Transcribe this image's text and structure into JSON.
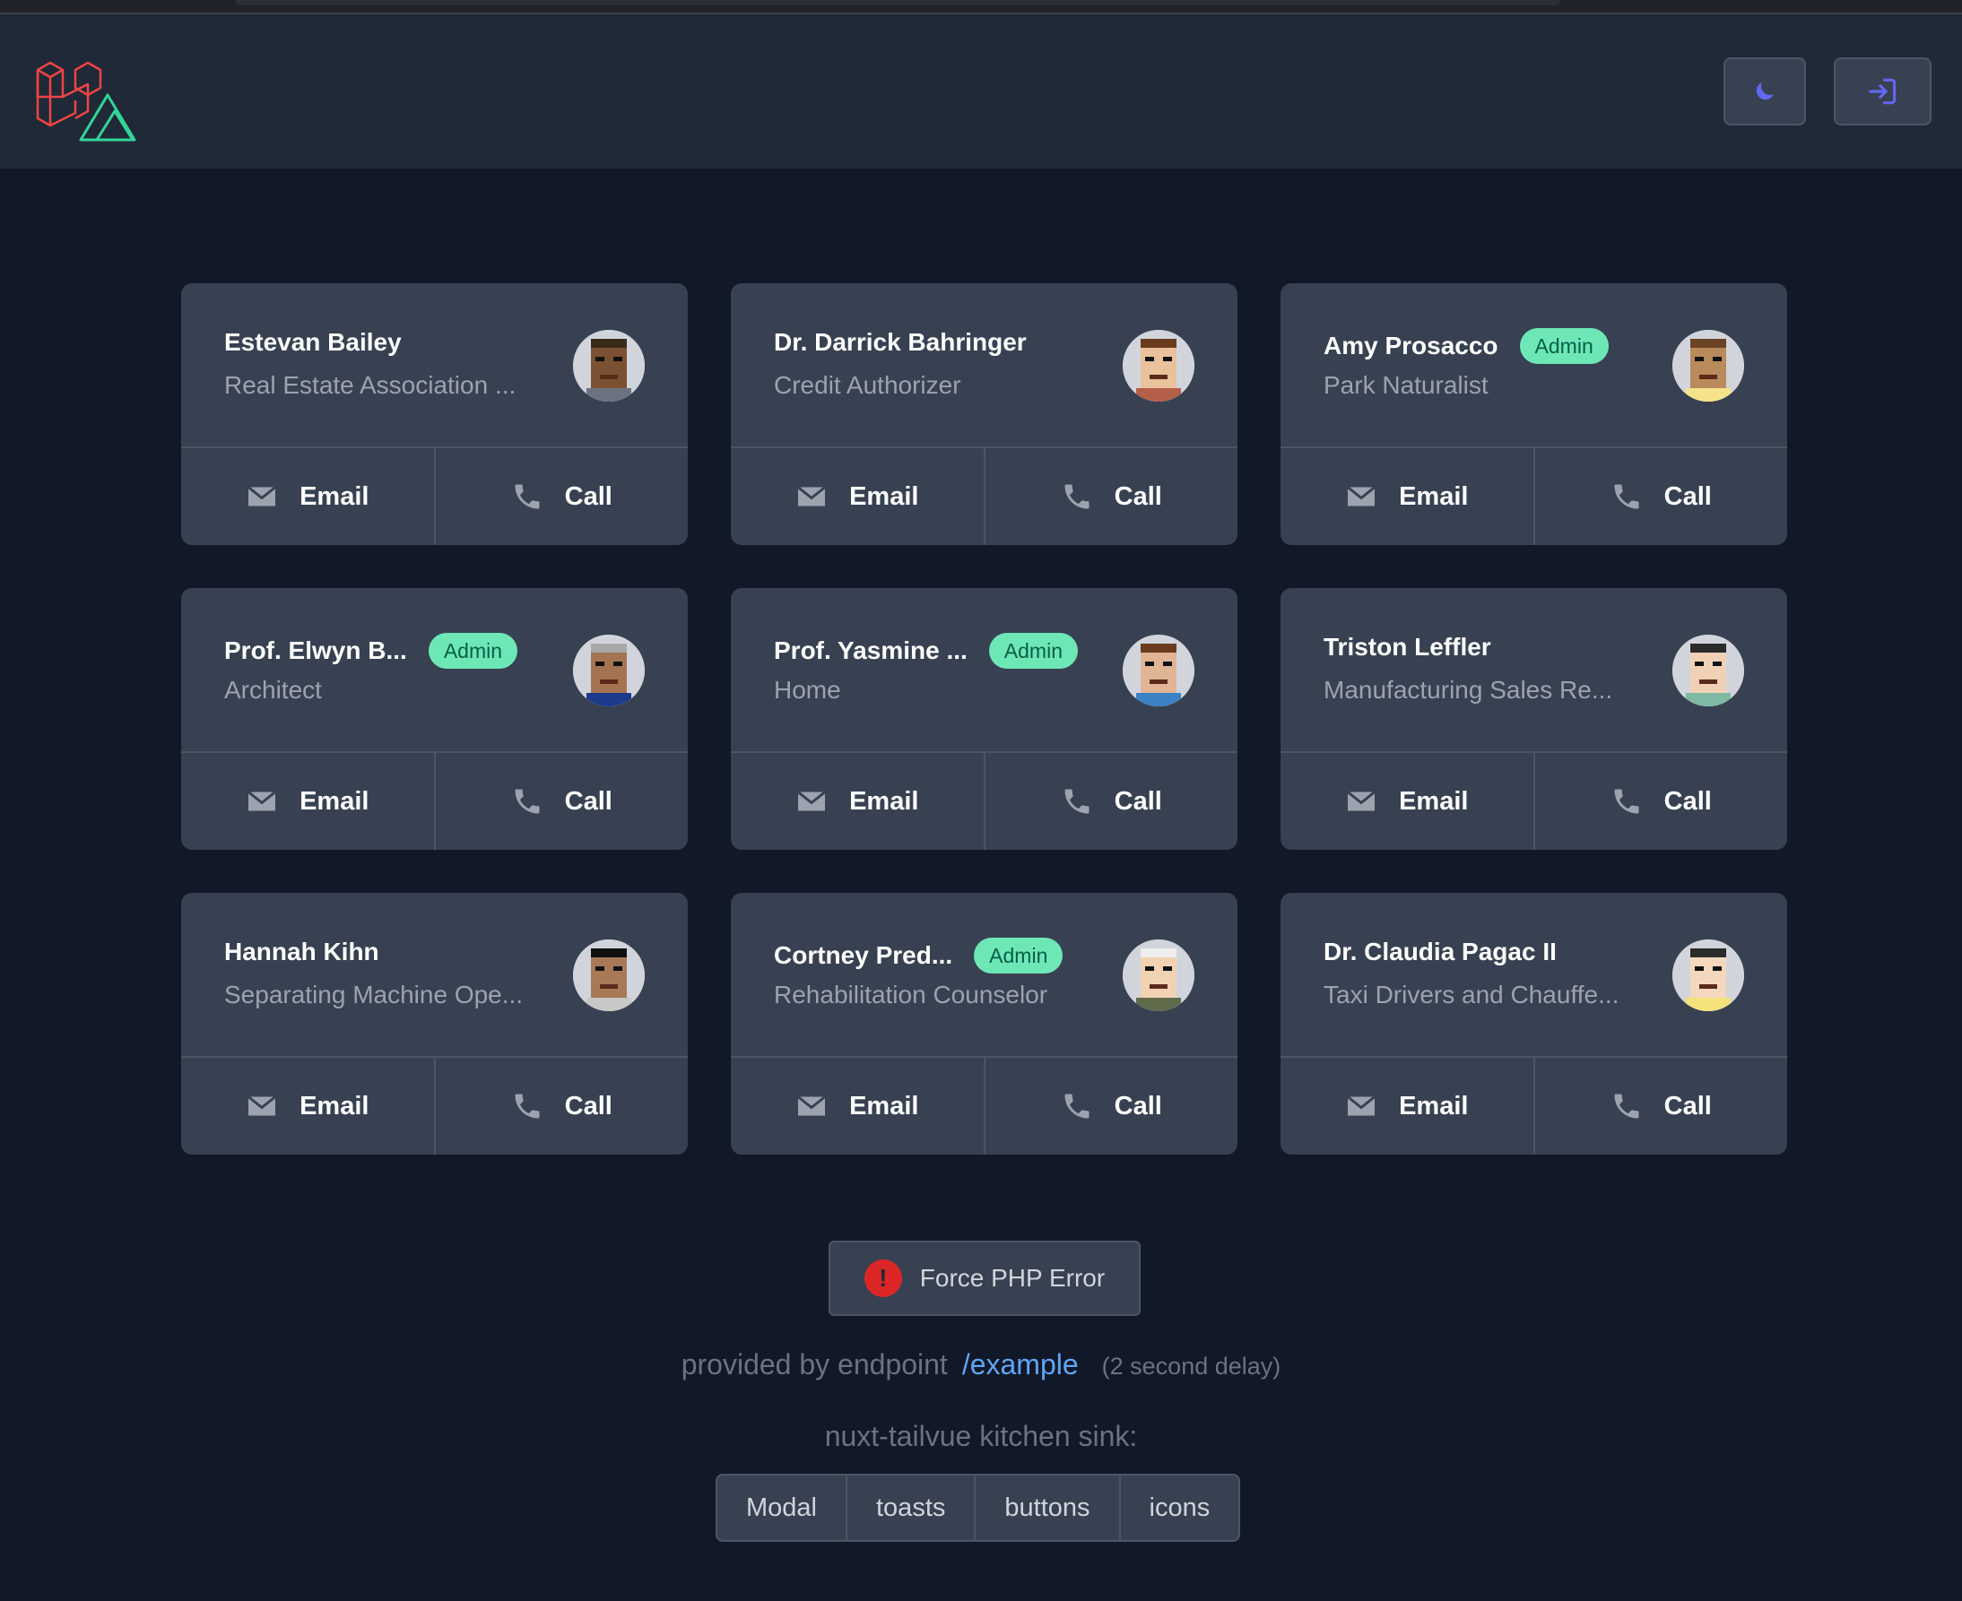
{
  "header": {
    "logo": "laravel-nuxt-logo",
    "theme_icon": "moon-icon",
    "login_icon": "login-icon",
    "accent": "#6366f1"
  },
  "users": [
    {
      "name": "Estevan Bailey",
      "title": "Real Estate Association ...",
      "admin": false,
      "avatar": {
        "skin": "#7a5132",
        "hair": "#3a2a1c",
        "shirt": "#6b7280"
      }
    },
    {
      "name": "Dr. Darrick Bahringer",
      "title": "Credit Authorizer",
      "admin": false,
      "avatar": {
        "skin": "#e9c29b",
        "hair": "#6b3b1f",
        "shirt": "#b45f4a"
      }
    },
    {
      "name": "Amy Prosacco",
      "title": "Park Naturalist",
      "admin": true,
      "avatar": {
        "skin": "#b98a5b",
        "hair": "#6a4424",
        "shirt": "#f5e38a"
      }
    },
    {
      "name": "Prof. Elwyn B...",
      "title": "Architect",
      "admin": true,
      "avatar": {
        "skin": "#a47452",
        "hair": "#a8a8a8",
        "shirt": "#1e3a8a"
      }
    },
    {
      "name": "Prof. Yasmine ...",
      "title": "Home",
      "admin": true,
      "avatar": {
        "skin": "#e0b596",
        "hair": "#6b3b1f",
        "shirt": "#3b82c4"
      }
    },
    {
      "name": "Triston Leffler",
      "title": "Manufacturing Sales Re...",
      "admin": false,
      "avatar": {
        "skin": "#f1d1b6",
        "hair": "#2b2b2b",
        "shirt": "#7fb9a4"
      }
    },
    {
      "name": "Hannah Kihn",
      "title": "Separating Machine Ope...",
      "admin": false,
      "avatar": {
        "skin": "#a87957",
        "hair": "#111111",
        "shirt": "#c8c8c8"
      }
    },
    {
      "name": "Cortney Pred...",
      "title": "Rehabilitation Counselor",
      "admin": true,
      "avatar": {
        "skin": "#f1d2b3",
        "hair": "#eeeeee",
        "shirt": "#5f6b4b"
      }
    },
    {
      "name": "Dr. Claudia Pagac II",
      "title": "Taxi Drivers and Chauffe...",
      "admin": false,
      "avatar": {
        "skin": "#f4d8bd",
        "hair": "#2b2b2b",
        "shirt": "#f3e27a"
      }
    }
  ],
  "labels": {
    "admin_badge": "Admin",
    "email": "Email",
    "call": "Call"
  },
  "error_button": {
    "label": "Force PHP Error",
    "icon": "exclamation-icon"
  },
  "provided": {
    "text": "provided by endpoint",
    "link": "/example",
    "delay": "(2 second delay)"
  },
  "kitchen_sink": {
    "heading": "nuxt-tailvue kitchen sink:",
    "items": [
      "Modal",
      "toasts",
      "buttons",
      "icons"
    ]
  }
}
